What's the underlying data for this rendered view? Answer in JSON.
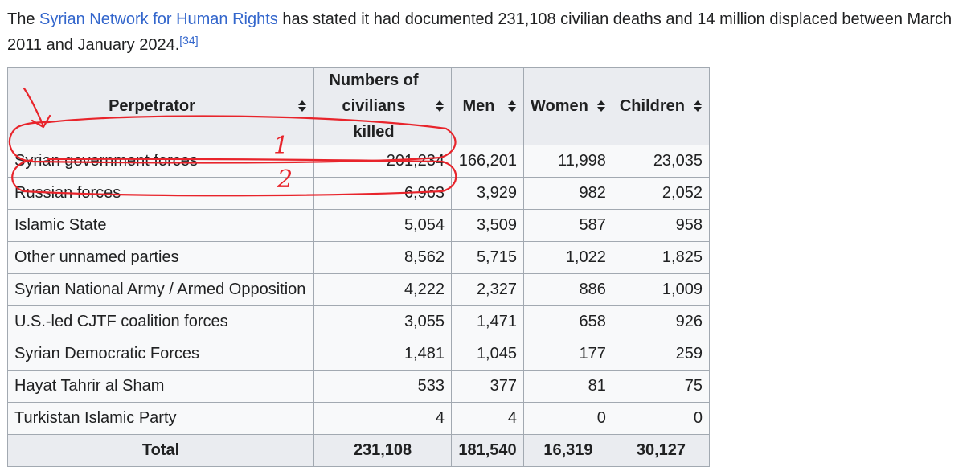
{
  "intro": {
    "before": "The ",
    "link": "Syrian Network for Human Rights",
    "after": " has stated it had documented 231,108 civilian deaths and 14 million displaced between March 2011 and January 2024.",
    "citation": "[34]"
  },
  "table": {
    "headers": {
      "perpetrator": "Perpetrator",
      "killed_line1": "Numbers of",
      "killed_line2": "civilians killed",
      "men": "Men",
      "women": "Women",
      "children": "Children"
    },
    "rows": [
      {
        "perpetrator": "Syrian government forces",
        "killed": "201,234",
        "men": "166,201",
        "women": "11,998",
        "children": "23,035"
      },
      {
        "perpetrator": "Russian forces",
        "killed": "6,963",
        "men": "3,929",
        "women": "982",
        "children": "2,052"
      },
      {
        "perpetrator": "Islamic State",
        "killed": "5,054",
        "men": "3,509",
        "women": "587",
        "children": "958"
      },
      {
        "perpetrator": "Other unnamed parties",
        "killed": "8,562",
        "men": "5,715",
        "women": "1,022",
        "children": "1,825"
      },
      {
        "perpetrator": "Syrian National Army / Armed Opposition",
        "killed": "4,222",
        "men": "2,327",
        "women": "886",
        "children": "1,009"
      },
      {
        "perpetrator": "U.S.-led CJTF coalition forces",
        "killed": "3,055",
        "men": "1,471",
        "women": "658",
        "children": "926"
      },
      {
        "perpetrator": "Syrian Democratic Forces",
        "killed": "1,481",
        "men": "1,045",
        "women": "177",
        "children": "259"
      },
      {
        "perpetrator": "Hayat Tahrir al Sham",
        "killed": "533",
        "men": "377",
        "women": "81",
        "children": "75"
      },
      {
        "perpetrator": "Turkistan Islamic Party",
        "killed": "4",
        "men": "4",
        "women": "0",
        "children": "0"
      }
    ],
    "total": {
      "label": "Total",
      "killed": "231,108",
      "men": "181,540",
      "women": "16,319",
      "children": "30,127"
    }
  },
  "annotation": {
    "color": "#e8242b",
    "marks": [
      "1",
      "2"
    ]
  },
  "colors": {
    "link": "#3366cc",
    "header_bg": "#eaecf0",
    "cell_bg": "#f8f9fa",
    "border": "#a2a9b1"
  },
  "icons": {
    "sort": "sort-up-down-icon"
  }
}
